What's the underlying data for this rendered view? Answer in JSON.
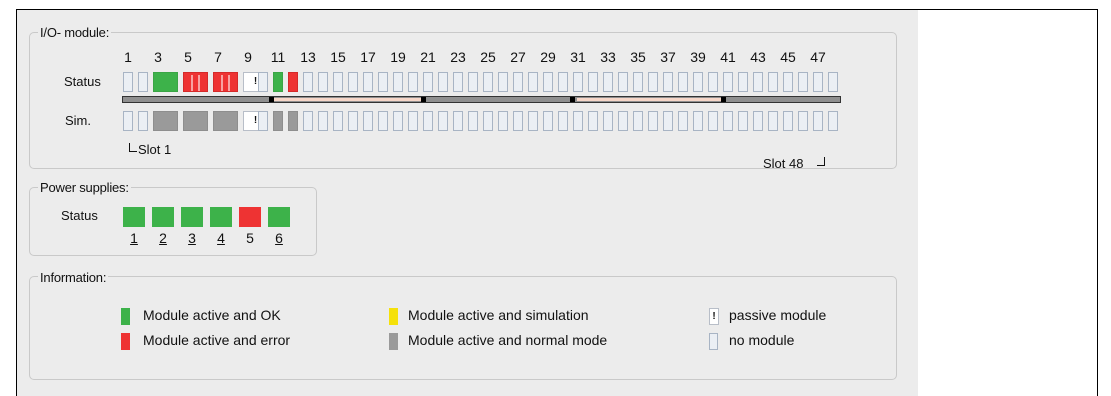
{
  "io_module": {
    "title": "I/O- module:",
    "slot_numbers": [
      "1",
      "3",
      "5",
      "7",
      "9",
      "11",
      "13",
      "15",
      "17",
      "19",
      "21",
      "23",
      "25",
      "27",
      "29",
      "31",
      "33",
      "35",
      "37",
      "39",
      "41",
      "43",
      "45",
      "47"
    ],
    "status_label": "Status",
    "sim_label": "Sim.",
    "slot_first": "Slot 1",
    "slot_last": "Slot 48",
    "status_slots": [
      "empty",
      "empty",
      "green",
      "green",
      "red",
      "red",
      "red",
      "red",
      "passive",
      "empty",
      "green",
      "red",
      "empty",
      "empty",
      "empty",
      "empty",
      "empty",
      "empty",
      "empty",
      "empty",
      "empty",
      "empty",
      "empty",
      "empty",
      "empty",
      "empty",
      "empty",
      "empty",
      "empty",
      "empty",
      "empty",
      "empty",
      "empty",
      "empty",
      "empty",
      "empty",
      "empty",
      "empty",
      "empty",
      "empty",
      "empty",
      "empty",
      "empty",
      "empty",
      "empty",
      "empty",
      "empty",
      "empty"
    ],
    "sim_slots": [
      "empty",
      "empty",
      "grey",
      "grey",
      "grey",
      "grey",
      "grey",
      "grey",
      "passive",
      "empty",
      "grey",
      "grey",
      "empty",
      "empty",
      "empty",
      "empty",
      "empty",
      "empty",
      "empty",
      "empty",
      "empty",
      "empty",
      "empty",
      "empty",
      "empty",
      "empty",
      "empty",
      "empty",
      "empty",
      "empty",
      "empty",
      "empty",
      "empty",
      "empty",
      "empty",
      "empty",
      "empty",
      "empty",
      "empty",
      "empty",
      "empty",
      "empty",
      "empty",
      "empty",
      "empty",
      "empty",
      "empty",
      "empty"
    ],
    "passive_glyph": "!"
  },
  "power_supplies": {
    "title": "Power supplies:",
    "status_label": "Status",
    "units": [
      {
        "label": "1",
        "state": "green"
      },
      {
        "label": "2",
        "state": "green"
      },
      {
        "label": "3",
        "state": "green"
      },
      {
        "label": "4",
        "state": "green"
      },
      {
        "label": "5",
        "state": "red"
      },
      {
        "label": "6",
        "state": "green"
      }
    ]
  },
  "information": {
    "title": "Information:",
    "legend": [
      {
        "label": "Module active and OK",
        "icon": "green-swatch-icon",
        "color": "#3db24a"
      },
      {
        "label": "Module active and error",
        "icon": "red-swatch-icon",
        "color": "#ee3333"
      },
      {
        "label": "Module active and simulation",
        "icon": "yellow-swatch-icon",
        "color": "#f5e10a"
      },
      {
        "label": "Module active and normal mode",
        "icon": "grey-swatch-icon",
        "color": "#9a9a9a"
      },
      {
        "label": "passive module",
        "icon": "passive-module-icon",
        "glyph": "!"
      },
      {
        "label": "no module",
        "icon": "empty-slot-icon",
        "color": "#ebeff4"
      }
    ]
  }
}
